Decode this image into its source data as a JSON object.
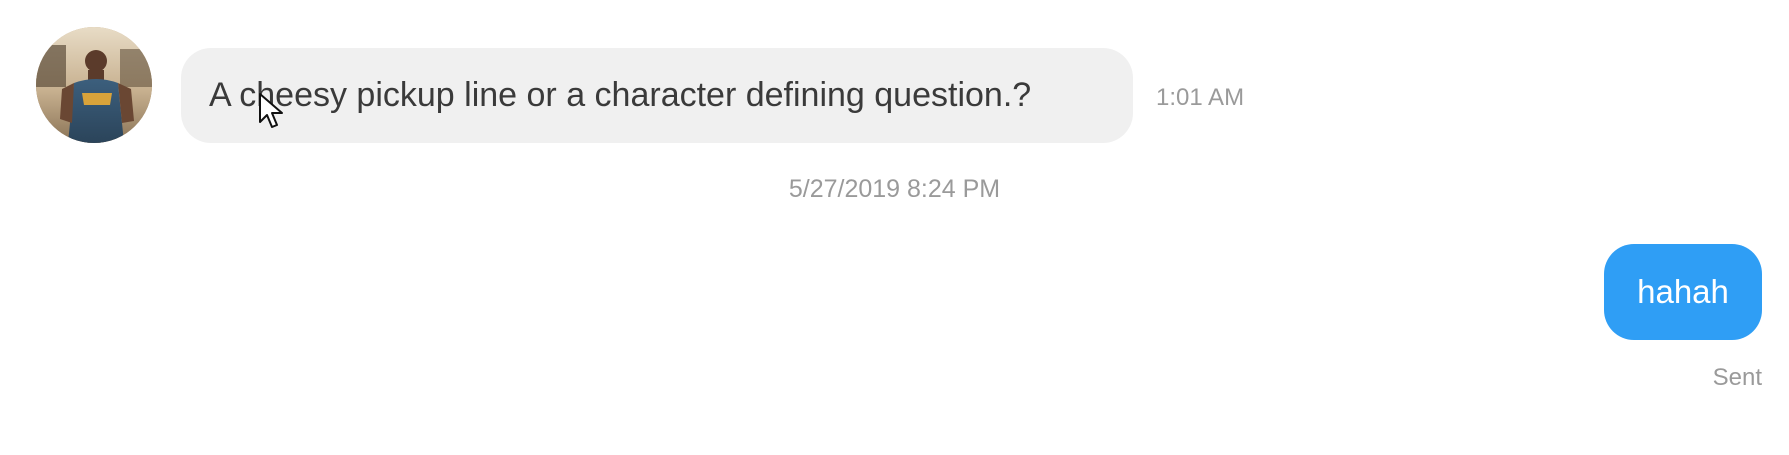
{
  "conversation": {
    "incoming_message": {
      "text": "A cheesy pickup line or a character defining question.?",
      "time": "1:01 AM"
    },
    "date_divider": "5/27/2019 8:24 PM",
    "outgoing_message": {
      "text": "hahah",
      "status": "Sent"
    }
  },
  "colors": {
    "incoming_bubble": "#f0f0f0",
    "outgoing_bubble": "#2f9ef5",
    "meta_text": "#9a9a9a",
    "message_text": "#3a3a3a"
  },
  "icons": {
    "pointer": "cursor-pointer-icon"
  }
}
